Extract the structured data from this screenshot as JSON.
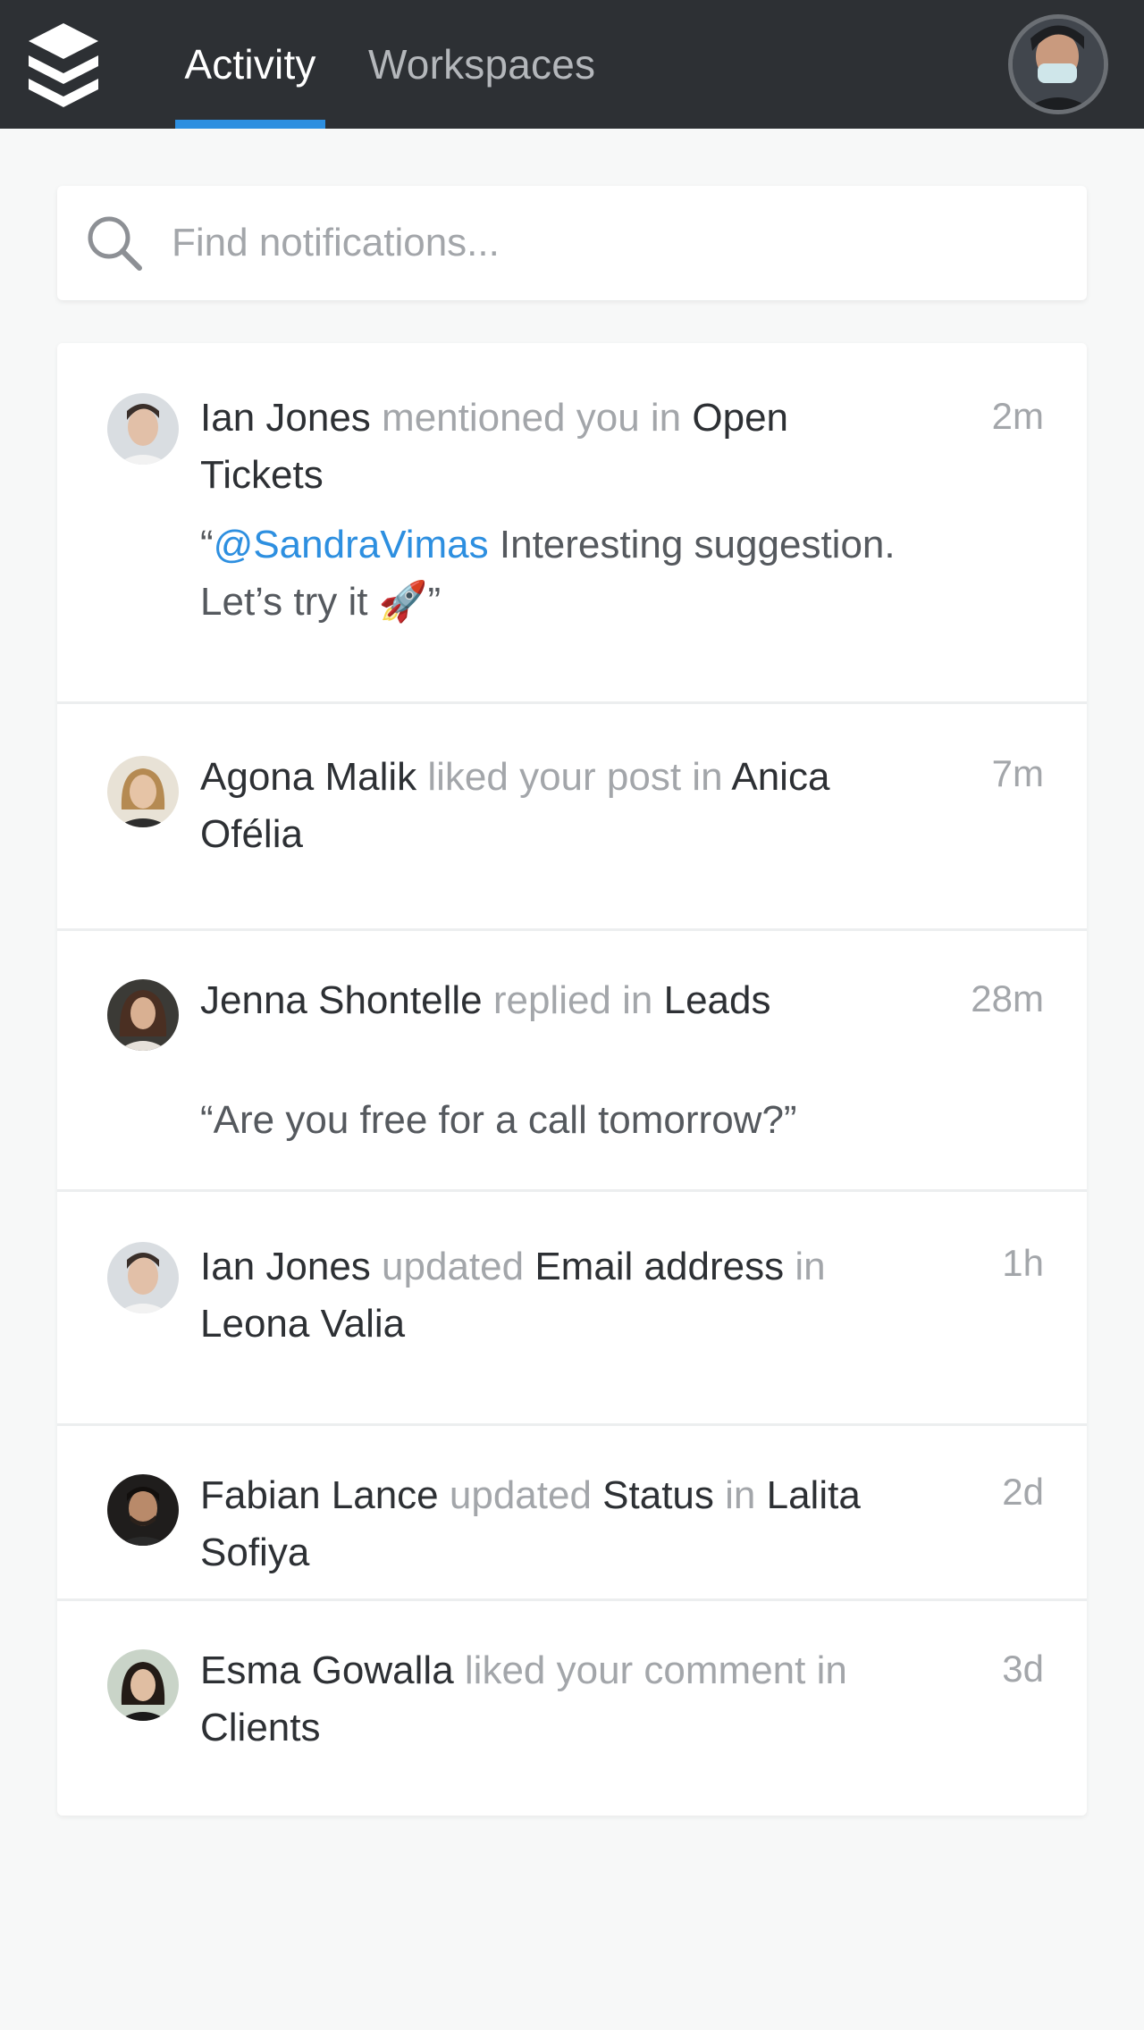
{
  "nav": {
    "tabs": [
      {
        "label": "Activity",
        "active": true
      },
      {
        "label": "Workspaces",
        "active": false
      }
    ],
    "accent_color": "#2d8fe0",
    "bar_color": "#2d3034"
  },
  "search": {
    "placeholder": "Find notifications..."
  },
  "notifications": [
    {
      "actor": "Ian Jones",
      "action": " mentioned you in ",
      "target": "Open Tickets",
      "time": "2m",
      "quote_open": "“",
      "mention": "@SandraVimas",
      "quote_text": " Interesting suggestion. Let’s try it 🚀”"
    },
    {
      "actor": "Agona Malik",
      "action": " liked your post in ",
      "target": "Anica Ofélia",
      "time": "7m"
    },
    {
      "actor": "Jenna Shontelle",
      "action": " replied in ",
      "target": "Leads",
      "time": "28m",
      "quote": "“Are you free for a call tomorrow?”"
    },
    {
      "actor": "Ian Jones",
      "action": " updated ",
      "field": "Email address",
      "connector": " in ",
      "target": "Leona Valia",
      "time": "1h"
    },
    {
      "actor": "Fabian Lance",
      "action": " updated ",
      "field": "Status",
      "connector": " in ",
      "target": "Lalita Sofiya",
      "time": "2d"
    },
    {
      "actor": "Esma Gowalla",
      "action": " liked your comment in ",
      "target": "Clients",
      "time": "3d"
    }
  ]
}
